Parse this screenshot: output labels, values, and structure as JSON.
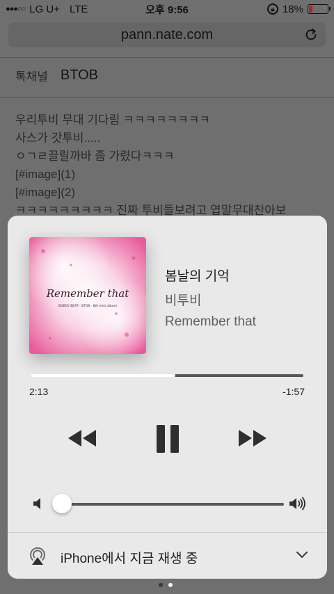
{
  "status_bar": {
    "carrier": "LG U+",
    "network": "LTE",
    "time": "오후 9:56",
    "battery_percent": "18%",
    "battery_level": 0.18,
    "signal_icon": "signal-dots-icon",
    "lock_icon": "orientation-lock-icon"
  },
  "browser": {
    "url": "pann.nate.com",
    "reload_icon": "reload-icon"
  },
  "page": {
    "channel_label": "톡채널",
    "channel_value": "BTOB",
    "lines": [
      "우리투비 무대 기다림 ㅋㅋㅋㅋㅋㅋㅋㅋ",
      "사스가 갓투비.....",
      "ㅇㄱㄹ끌릴까바 좀 가렸다ㅋㅋㅋ",
      "[#image](1)",
      "[#image](2)",
      "ㅋㅋㅋㅋㅋㅋㅋㅋㅋ 진짜 투비들보려고 엽말무대찬아보"
    ]
  },
  "player": {
    "artwork_text": "Remember that",
    "artwork_subtitle": "BOBOY BEAT · BTOB · 8th mini album",
    "title": "봄날의 기억",
    "artist": "비투비",
    "album": "Remember that",
    "elapsed": "2:13",
    "remaining": "-1:57",
    "progress": 0.53,
    "volume": 0.03,
    "airplay_label": "iPhone에서 지금 재생 중"
  },
  "colors": {
    "card_bg": "#e9e9e9",
    "track_bg": "#585858",
    "track_fill": "#ffffff",
    "artwork_pink": "#e85c9c",
    "battery_low": "#b3261e"
  }
}
